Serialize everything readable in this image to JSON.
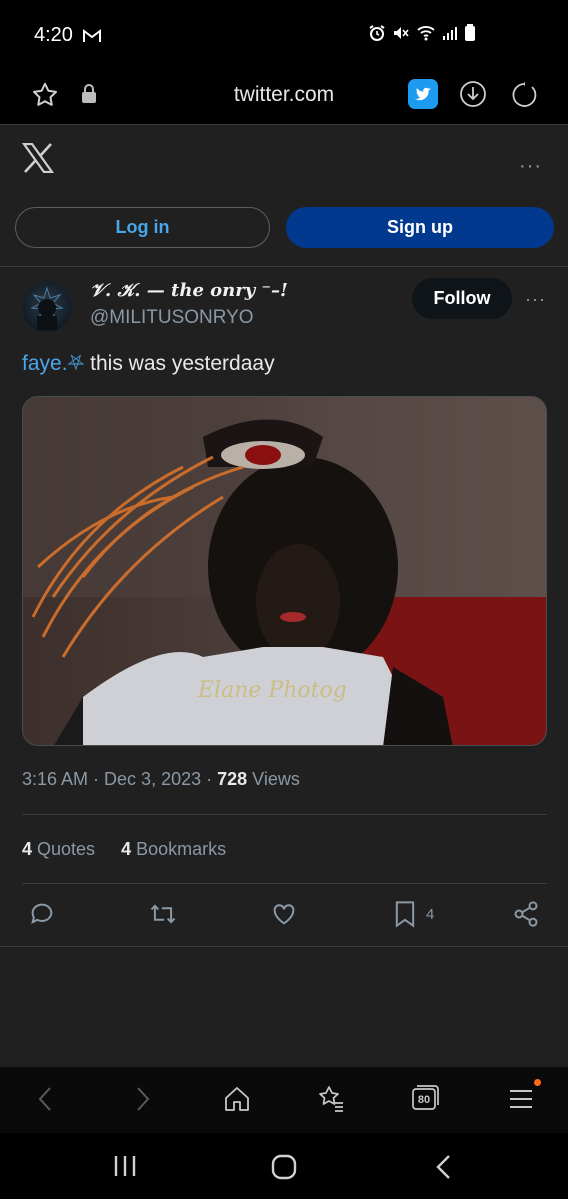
{
  "status_bar": {
    "time": "4:20"
  },
  "browser": {
    "url": "twitter.com",
    "tab_count": "80"
  },
  "top": {
    "more": "···"
  },
  "auth": {
    "login_label": "Log in",
    "signup_label": "Sign up"
  },
  "tweet": {
    "display_name": "𝒱. 𝒦. — the onry ⁻–!",
    "handle": "@MILITUSONRYO",
    "follow_label": "Follow",
    "more": "···",
    "text_link": "faye.⛧",
    "text_body": " this was yesterdaay",
    "media_watermark": "Elane Photog",
    "time": "3:16 AM",
    "sep1": " · ",
    "date": "Dec 3, 2023",
    "sep2": " · ",
    "views_count": "728",
    "views_label": " Views",
    "quotes_count": "4",
    "quotes_label": " Quotes",
    "bookmarks_count": "4",
    "bookmarks_label": " Bookmarks",
    "bookmark_action_count": "4"
  },
  "colors": {
    "accent": "#1d9bf0",
    "signup_bg": "#00398e",
    "follow_bg": "#0f1419"
  }
}
